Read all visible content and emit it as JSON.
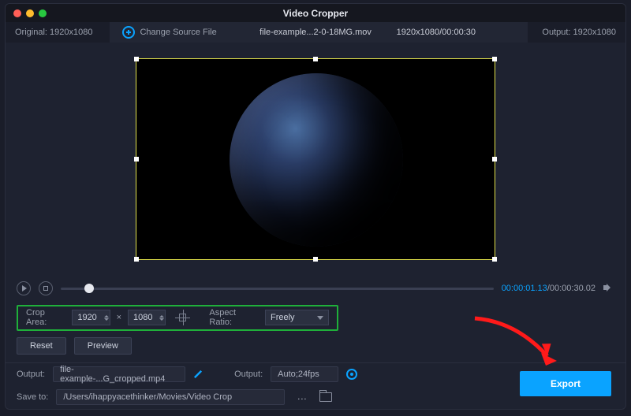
{
  "title": "Video Cropper",
  "header": {
    "original_label": "Original:",
    "original_res": "1920x1080",
    "change_source": "Change Source File",
    "filename": "file-example...2-0-18MG.mov",
    "src_res_time": "1920x1080/00:00:30",
    "output_label": "Output:",
    "output_res": "1920x1080"
  },
  "playback": {
    "current": "00:00:01.13",
    "total": "00:00:30.02"
  },
  "crop": {
    "label": "Crop Area:",
    "w": "1920",
    "h": "1080",
    "mult": "×",
    "aspect_label": "Aspect Ratio:",
    "aspect_value": "Freely"
  },
  "buttons": {
    "reset": "Reset",
    "preview": "Preview",
    "export": "Export"
  },
  "output": {
    "label1": "Output:",
    "file": "file-example-...G_cropped.mp4",
    "label2": "Output:",
    "fmt": "Auto;24fps",
    "save_label": "Save to:",
    "save_path": "/Users/ihappyacethinker/Movies/Video Crop",
    "dots": "..."
  }
}
